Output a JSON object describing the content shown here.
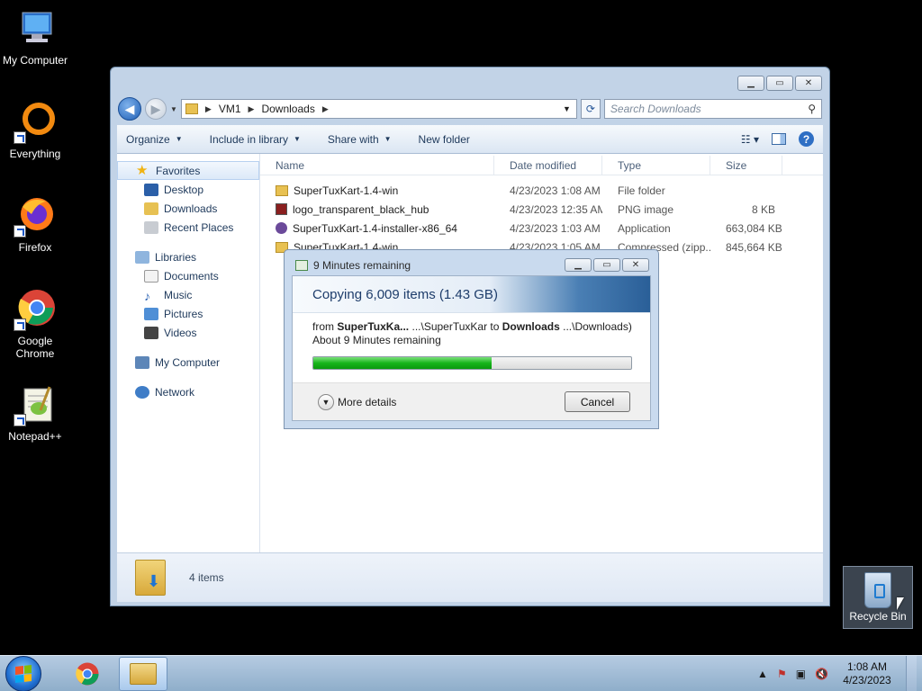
{
  "desktop": {
    "icons": [
      {
        "label": "My Computer"
      },
      {
        "label": "Everything"
      },
      {
        "label": "Firefox"
      },
      {
        "label": "Google Chrome"
      },
      {
        "label": "Notepad++"
      }
    ],
    "recycle_bin": "Recycle Bin"
  },
  "explorer": {
    "breadcrumb": [
      "VM1",
      "Downloads"
    ],
    "search_placeholder": "Search Downloads",
    "toolbar": {
      "organize": "Organize",
      "include_library": "Include in library",
      "share_with": "Share with",
      "new_folder": "New folder"
    },
    "nav": {
      "favorites": "Favorites",
      "desktop": "Desktop",
      "downloads": "Downloads",
      "recent_places": "Recent Places",
      "libraries": "Libraries",
      "documents": "Documents",
      "music": "Music",
      "pictures": "Pictures",
      "videos": "Videos",
      "my_computer": "My Computer",
      "network": "Network"
    },
    "columns": {
      "name": "Name",
      "date": "Date modified",
      "type": "Type",
      "size": "Size"
    },
    "files": [
      {
        "name": "SuperTuxKart-1.4-win",
        "date": "4/23/2023 1:08 AM",
        "type": "File folder",
        "size": ""
      },
      {
        "name": "logo_transparent_black_hub",
        "date": "4/23/2023 12:35 AM",
        "type": "PNG image",
        "size": "8 KB"
      },
      {
        "name": "SuperTuxKart-1.4-installer-x86_64",
        "date": "4/23/2023 1:03 AM",
        "type": "Application",
        "size": "663,084 KB"
      },
      {
        "name": "SuperTuxKart-1.4-win",
        "date": "4/23/2023 1:05 AM",
        "type": "Compressed (zipp...",
        "size": "845,664 KB"
      }
    ],
    "item_count": "4 items"
  },
  "copy_dialog": {
    "title": "9 Minutes remaining",
    "heading": "Copying 6,009 items (1.43 GB)",
    "from_prefix": "from",
    "from_name": "SuperTuxKa...",
    "from_path": "...\\SuperTuxKar to",
    "to_name": "Downloads",
    "to_path": "...\\Downloads)",
    "remaining": "About 9 Minutes remaining",
    "progress_fraction": 0.56,
    "more_details": "More details",
    "cancel": "Cancel"
  },
  "taskbar": {
    "time": "1:08 AM",
    "date": "4/23/2023"
  }
}
